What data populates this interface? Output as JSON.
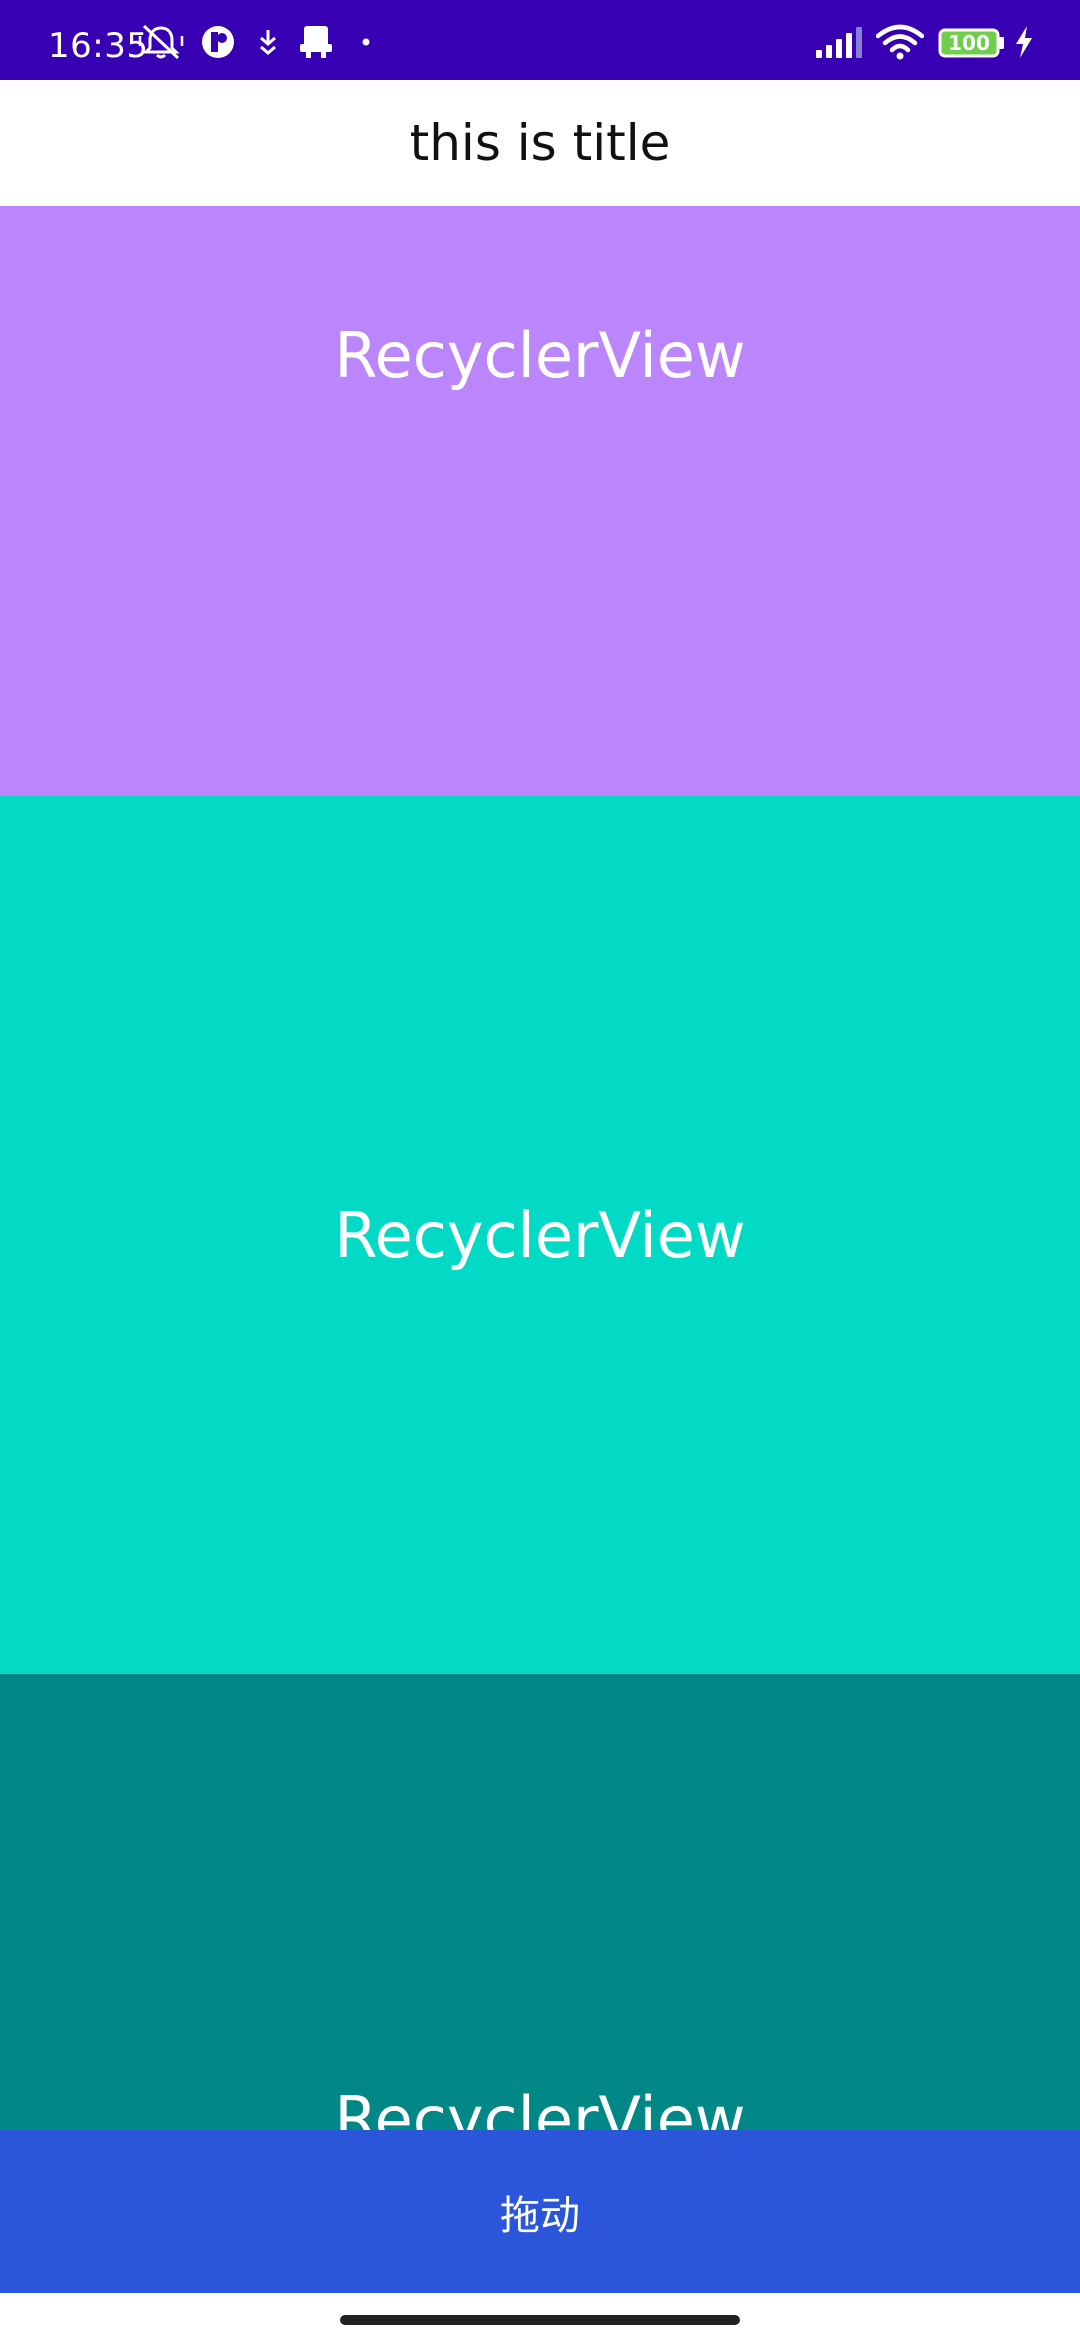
{
  "status_bar": {
    "time": "16:35",
    "battery_level": "100",
    "icons": [
      "silent-mode-icon",
      "app-notification-icon",
      "download-icon",
      "printer-icon",
      "dot-icon",
      "signal-icon",
      "wifi-icon",
      "battery-icon",
      "charging-icon"
    ],
    "background": "#3700b3"
  },
  "title_bar": {
    "title": "this is title"
  },
  "panels": [
    {
      "label": "RecyclerView",
      "color": "#bb86fc"
    },
    {
      "label": "RecyclerView",
      "color": "#03dac5"
    },
    {
      "label": "RecyclerView",
      "color": "#018786"
    }
  ],
  "drag_button": {
    "label": "拖动",
    "color": "#2b56da"
  }
}
